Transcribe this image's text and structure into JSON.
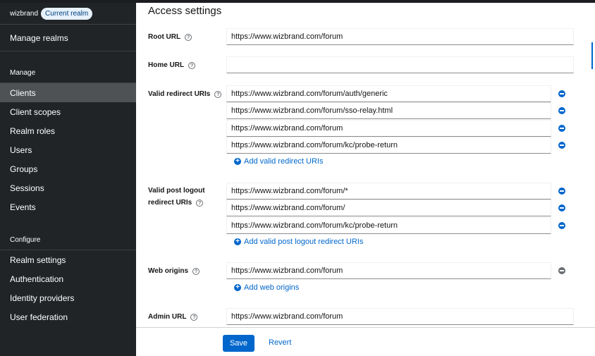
{
  "sidebar": {
    "realm_name": "wizbrand",
    "realm_badge": "Current realm",
    "manage_realms": "Manage realms",
    "manage_section": "Manage",
    "manage_items": [
      "Clients",
      "Client scopes",
      "Realm roles",
      "Users",
      "Groups",
      "Sessions",
      "Events"
    ],
    "configure_section": "Configure",
    "configure_items": [
      "Realm settings",
      "Authentication",
      "Identity providers",
      "User federation"
    ]
  },
  "main": {
    "title": "Access settings",
    "root_url": {
      "label": "Root URL",
      "value": "https://www.wizbrand.com/forum"
    },
    "home_url": {
      "label": "Home URL",
      "value": ""
    },
    "redirect_uris": {
      "label": "Valid redirect URIs",
      "values": [
        "https://www.wizbrand.com/forum/auth/generic",
        "https://www.wizbrand.com/forum/sso-relay.html",
        "https://www.wizbrand.com/forum",
        "https://www.wizbrand.com/forum/kc/probe-return"
      ],
      "add_label": "Add valid redirect URIs"
    },
    "post_logout": {
      "label_line1": "Valid post logout",
      "label_line2": "redirect URIs",
      "values": [
        "https://www.wizbrand.com/forum/*",
        "https://www.wizbrand.com/forum/",
        "https://www.wizbrand.com/forum/kc/probe-return"
      ],
      "add_label": "Add valid post logout redirect URIs"
    },
    "web_origins": {
      "label": "Web origins",
      "values": [
        "https://www.wizbrand.com/forum"
      ],
      "add_label": "Add web origins"
    },
    "admin_url": {
      "label": "Admin URL",
      "value": "https://www.wizbrand.com/forum"
    },
    "help_glyph": "?",
    "plus_glyph": "+"
  },
  "footer": {
    "save_label": "Save",
    "revert_label": "Revert"
  },
  "colors": {
    "sidebar_bg": "#212427",
    "sidebar_active": "#4f5255",
    "accent": "#0066cc"
  }
}
